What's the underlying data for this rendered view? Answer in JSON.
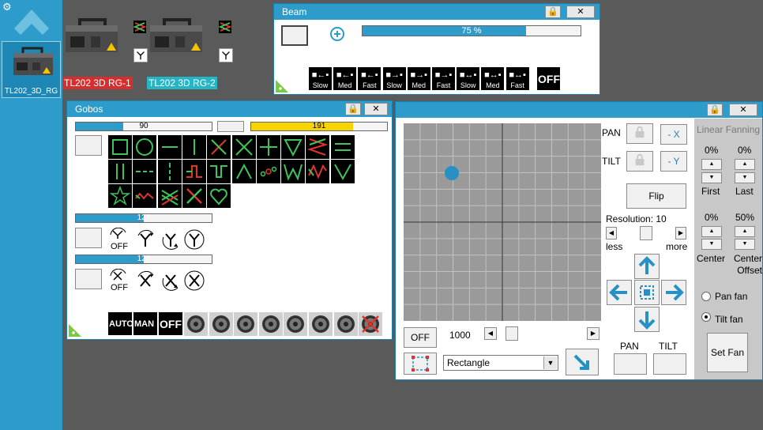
{
  "sidebar": {
    "fixture_label": "TL202_3D_RG"
  },
  "fixtures": [
    {
      "label": "TL202 3D RG-1",
      "color": "#d32f2f"
    },
    {
      "label": "TL202 3D RG-2",
      "color": "#26b5c4"
    }
  ],
  "beam": {
    "title": "Beam",
    "progress_text": "75 %",
    "progress_value": 0.75,
    "buttons": [
      {
        "dir": "←",
        "label": "Slow"
      },
      {
        "dir": "←",
        "label": "Med"
      },
      {
        "dir": "←",
        "label": "Fast"
      },
      {
        "dir": "→",
        "label": "Slow"
      },
      {
        "dir": "→",
        "label": "Med"
      },
      {
        "dir": "→",
        "label": "Fast"
      },
      {
        "dir": "↔",
        "label": "Slow"
      },
      {
        "dir": "↔",
        "label": "Med"
      },
      {
        "dir": "↔",
        "label": "Fast"
      }
    ],
    "off_label": "OFF"
  },
  "gobos": {
    "title": "Gobos",
    "bar1_text": "90",
    "bar1_value": 0.35,
    "bar2_text": "191",
    "bar2_value": 0.75,
    "bar3_text": "128",
    "bar3_value": 0.5,
    "bar4_text": "128",
    "bar4_value": 0.5,
    "y_off_label": "OFF",
    "x_off_label": "OFF",
    "bottom": {
      "auto": "AUTO",
      "man": "MAN",
      "off": "OFF"
    }
  },
  "pantilt": {
    "pan_label": "PAN",
    "tilt_label": "TILT",
    "minus_x": "- X",
    "minus_y": "- Y",
    "flip": "Flip",
    "resolution": "Resolution: 10",
    "less": "less",
    "more": "more",
    "off": "OFF",
    "speed_value": "1000",
    "shape_select": "Rectangle",
    "pan_bottom": "PAN",
    "tilt_bottom": "TILT"
  },
  "fanning": {
    "title": "Linear Fanning",
    "first_pct": "0%",
    "last_pct": "0%",
    "first": "First",
    "last": "Last",
    "center_pct": "0%",
    "offset_pct": "50%",
    "center": "Center",
    "center_offset": "Center Offset",
    "pan_fan": "Pan fan",
    "tilt_fan": "Tilt fan",
    "set_fan": "Set Fan"
  },
  "colors": {
    "accent": "#2d9ccb",
    "green": "#3fc35c",
    "red": "#e0342c",
    "yellow": "#f7d400"
  }
}
